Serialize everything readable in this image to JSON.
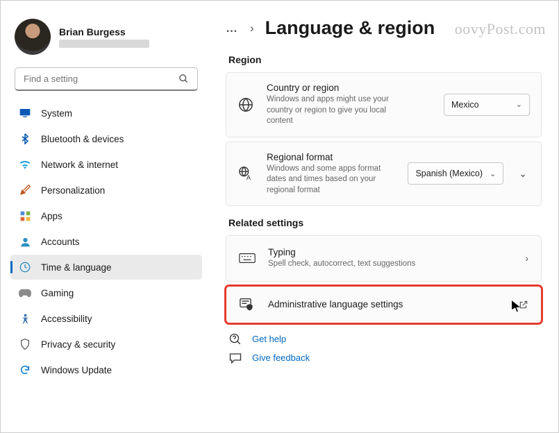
{
  "watermark": "oovyPost.com",
  "user": {
    "name": "Brian Burgess"
  },
  "search": {
    "placeholder": "Find a setting"
  },
  "sidebar": {
    "items": [
      {
        "label": "System"
      },
      {
        "label": "Bluetooth & devices"
      },
      {
        "label": "Network & internet"
      },
      {
        "label": "Personalization"
      },
      {
        "label": "Apps"
      },
      {
        "label": "Accounts"
      },
      {
        "label": "Time & language"
      },
      {
        "label": "Gaming"
      },
      {
        "label": "Accessibility"
      },
      {
        "label": "Privacy & security"
      },
      {
        "label": "Windows Update"
      }
    ]
  },
  "breadcrumb": {
    "more": "…",
    "sep": "›",
    "title": "Language & region"
  },
  "sections": {
    "region": {
      "label": "Region",
      "country": {
        "title": "Country or region",
        "desc": "Windows and apps might use your country or region to give you local content",
        "value": "Mexico"
      },
      "format": {
        "title": "Regional format",
        "desc": "Windows and some apps format dates and times based on your regional format",
        "value": "Spanish (Mexico)"
      }
    },
    "related": {
      "label": "Related settings",
      "typing": {
        "title": "Typing",
        "desc": "Spell check, autocorrect, text suggestions"
      },
      "admin": {
        "title": "Administrative language settings"
      }
    }
  },
  "links": {
    "help": "Get help",
    "feedback": "Give feedback"
  }
}
